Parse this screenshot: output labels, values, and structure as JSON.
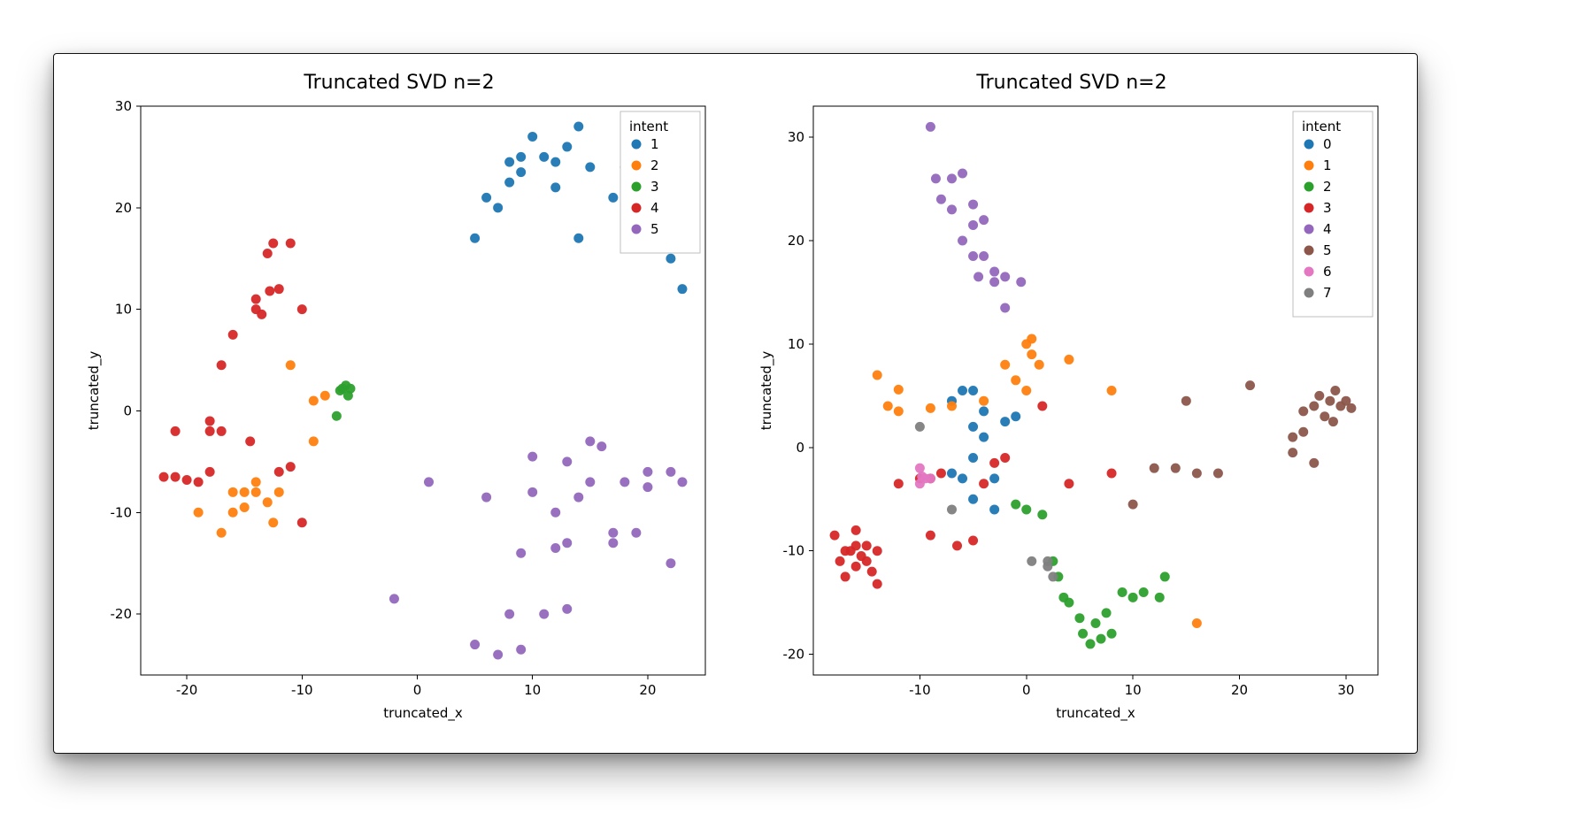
{
  "chart_data": [
    {
      "type": "scatter",
      "title": "Truncated SVD n=2",
      "xlabel": "truncated_x",
      "ylabel": "truncated_y",
      "xlim": [
        -24,
        25
      ],
      "ylim": [
        -26,
        30
      ],
      "xticks": [
        -20,
        -10,
        0,
        10,
        20
      ],
      "yticks": [
        -20,
        -10,
        0,
        10,
        20,
        30
      ],
      "legend_title": "intent",
      "legend_labels": [
        "1",
        "2",
        "3",
        "4",
        "5"
      ],
      "colors": {
        "1": "#1f77b4",
        "2": "#ff7f0e",
        "3": "#2ca02c",
        "4": "#d62728",
        "5": "#9467bd"
      },
      "series": [
        {
          "name": "1",
          "points": [
            [
              5,
              17
            ],
            [
              6,
              21
            ],
            [
              7,
              20
            ],
            [
              8,
              24.5
            ],
            [
              8,
              22.5
            ],
            [
              9,
              23.5
            ],
            [
              9,
              25
            ],
            [
              10,
              27
            ],
            [
              11,
              25
            ],
            [
              12,
              24.5
            ],
            [
              12,
              22
            ],
            [
              13,
              26
            ],
            [
              14,
              28
            ],
            [
              14,
              17
            ],
            [
              15,
              24
            ],
            [
              17,
              21
            ],
            [
              18,
              24
            ],
            [
              19,
              21
            ],
            [
              22,
              15
            ],
            [
              23,
              12
            ]
          ]
        },
        {
          "name": "2",
          "points": [
            [
              -19,
              -10
            ],
            [
              -17,
              -12
            ],
            [
              -16,
              -10
            ],
            [
              -16,
              -8
            ],
            [
              -15,
              -8
            ],
            [
              -15,
              -9.5
            ],
            [
              -14,
              -8
            ],
            [
              -14,
              -7
            ],
            [
              -13,
              -9
            ],
            [
              -12.5,
              -11
            ],
            [
              -12,
              -8
            ],
            [
              -11,
              4.5
            ],
            [
              -9,
              1
            ],
            [
              -9,
              -3
            ],
            [
              -8,
              1.5
            ]
          ]
        },
        {
          "name": "3",
          "points": [
            [
              -7,
              -0.5
            ],
            [
              -6.7,
              2
            ],
            [
              -6,
              1.5
            ],
            [
              -6.5,
              2.2
            ],
            [
              -6.2,
              2.5
            ],
            [
              -5.8,
              2.2
            ]
          ]
        },
        {
          "name": "4",
          "points": [
            [
              -22,
              -6.5
            ],
            [
              -21,
              -6.5
            ],
            [
              -21,
              -2
            ],
            [
              -20,
              -6.8
            ],
            [
              -19,
              -7
            ],
            [
              -18,
              -1
            ],
            [
              -18,
              -6
            ],
            [
              -18,
              -2
            ],
            [
              -17,
              -2
            ],
            [
              -17,
              4.5
            ],
            [
              -16,
              7.5
            ],
            [
              -14.5,
              -3
            ],
            [
              -14,
              11
            ],
            [
              -14,
              10
            ],
            [
              -13.5,
              9.5
            ],
            [
              -13,
              15.5
            ],
            [
              -12.8,
              11.8
            ],
            [
              -12.5,
              16.5
            ],
            [
              -12,
              12
            ],
            [
              -12,
              -6
            ],
            [
              -11,
              16.5
            ],
            [
              -11,
              -5.5
            ],
            [
              -10,
              10
            ],
            [
              -10,
              -11
            ]
          ]
        },
        {
          "name": "5",
          "points": [
            [
              1,
              -7
            ],
            [
              -2,
              -18.5
            ],
            [
              5,
              -23
            ],
            [
              6,
              -8.5
            ],
            [
              7,
              -24
            ],
            [
              8,
              -20
            ],
            [
              9,
              -14
            ],
            [
              9,
              -23.5
            ],
            [
              10,
              -4.5
            ],
            [
              10,
              -8
            ],
            [
              11,
              -20
            ],
            [
              12,
              -10
            ],
            [
              12,
              -13.5
            ],
            [
              13,
              -5
            ],
            [
              13,
              -13
            ],
            [
              13,
              -19.5
            ],
            [
              14,
              -8.5
            ],
            [
              15,
              -3
            ],
            [
              15,
              -7
            ],
            [
              16,
              -3.5
            ],
            [
              17,
              -13
            ],
            [
              18,
              -7
            ],
            [
              17,
              -12
            ],
            [
              19,
              -12
            ],
            [
              20,
              -6
            ],
            [
              20,
              -7.5
            ],
            [
              22,
              -6
            ],
            [
              23,
              -7
            ],
            [
              22,
              -15
            ]
          ]
        }
      ]
    },
    {
      "type": "scatter",
      "title": "Truncated SVD n=2",
      "xlabel": "truncated_x",
      "ylabel": "truncated_y",
      "xlim": [
        -20,
        33
      ],
      "ylim": [
        -22,
        33
      ],
      "xticks": [
        -10,
        0,
        10,
        20,
        30
      ],
      "yticks": [
        -20,
        -10,
        0,
        10,
        20,
        30
      ],
      "legend_title": "intent",
      "legend_labels": [
        "0",
        "1",
        "2",
        "3",
        "4",
        "5",
        "6",
        "7"
      ],
      "colors": {
        "0": "#1f77b4",
        "1": "#ff7f0e",
        "2": "#2ca02c",
        "3": "#d62728",
        "4": "#9467bd",
        "5": "#8c564b",
        "6": "#e377c2",
        "7": "#7f7f7f"
      },
      "series": [
        {
          "name": "0",
          "points": [
            [
              -7,
              4.5
            ],
            [
              -6,
              5.5
            ],
            [
              -5,
              5.5
            ],
            [
              -4,
              3.5
            ],
            [
              -5,
              2
            ],
            [
              -7,
              -2.5
            ],
            [
              -5,
              -1
            ],
            [
              -4,
              1
            ],
            [
              -6,
              -3
            ],
            [
              -5,
              -5
            ],
            [
              -3,
              -6
            ],
            [
              -3,
              -3
            ],
            [
              -2,
              2.5
            ],
            [
              -1,
              3
            ]
          ]
        },
        {
          "name": "1",
          "points": [
            [
              -14,
              7
            ],
            [
              -12,
              5.6
            ],
            [
              -13,
              4
            ],
            [
              -12,
              3.5
            ],
            [
              -9,
              3.8
            ],
            [
              -7,
              4
            ],
            [
              -4,
              4.5
            ],
            [
              -2,
              8
            ],
            [
              -1,
              6.5
            ],
            [
              0,
              10
            ],
            [
              0.5,
              9
            ],
            [
              0.5,
              10.5
            ],
            [
              0,
              5.5
            ],
            [
              1.2,
              8
            ],
            [
              4,
              8.5
            ],
            [
              8,
              5.5
            ],
            [
              16,
              -17
            ]
          ]
        },
        {
          "name": "2",
          "points": [
            [
              -1,
              -5.5
            ],
            [
              0,
              -6
            ],
            [
              1.5,
              -6.5
            ],
            [
              2.5,
              -11
            ],
            [
              3,
              -12.5
            ],
            [
              3.5,
              -14.5
            ],
            [
              4,
              -15
            ],
            [
              5,
              -16.5
            ],
            [
              5.3,
              -18
            ],
            [
              6,
              -19
            ],
            [
              6.5,
              -17
            ],
            [
              7,
              -18.5
            ],
            [
              7.5,
              -16
            ],
            [
              8,
              -18
            ],
            [
              9,
              -14
            ],
            [
              10,
              -14.5
            ],
            [
              11,
              -14
            ],
            [
              12.5,
              -14.5
            ],
            [
              13,
              -12.5
            ]
          ]
        },
        {
          "name": "3",
          "points": [
            [
              -18,
              -8.5
            ],
            [
              -17,
              -10
            ],
            [
              -17.5,
              -11
            ],
            [
              -16.5,
              -10
            ],
            [
              -17,
              -12.5
            ],
            [
              -16,
              -11.5
            ],
            [
              -16,
              -9.5
            ],
            [
              -16,
              -8
            ],
            [
              -15.5,
              -10.5
            ],
            [
              -15,
              -9.5
            ],
            [
              -15,
              -11
            ],
            [
              -14,
              -10
            ],
            [
              -14.5,
              -12
            ],
            [
              -14,
              -13.2
            ],
            [
              -12,
              -3.5
            ],
            [
              -10,
              -3
            ],
            [
              -9,
              -3
            ],
            [
              -9,
              -8.5
            ],
            [
              -8,
              -2.5
            ],
            [
              -6.5,
              -9.5
            ],
            [
              -5,
              -9
            ],
            [
              -4,
              -3.5
            ],
            [
              -3,
              -1.5
            ],
            [
              -2,
              -1
            ],
            [
              4,
              -3.5
            ],
            [
              1.5,
              4
            ],
            [
              8,
              -2.5
            ]
          ]
        },
        {
          "name": "4",
          "points": [
            [
              -9,
              31
            ],
            [
              -8.5,
              26
            ],
            [
              -8,
              24
            ],
            [
              -7,
              26
            ],
            [
              -7,
              23
            ],
            [
              -6,
              26.5
            ],
            [
              -6,
              20
            ],
            [
              -5,
              23.5
            ],
            [
              -5,
              21.5
            ],
            [
              -5,
              18.5
            ],
            [
              -4,
              18.5
            ],
            [
              -4,
              22
            ],
            [
              -4.5,
              16.5
            ],
            [
              -3,
              17
            ],
            [
              -3,
              16
            ],
            [
              -2,
              16.5
            ],
            [
              -2,
              13.5
            ],
            [
              -0.5,
              16
            ]
          ]
        },
        {
          "name": "5",
          "points": [
            [
              10,
              -5.5
            ],
            [
              12,
              -2
            ],
            [
              14,
              -2
            ],
            [
              15,
              4.5
            ],
            [
              16,
              -2.5
            ],
            [
              18,
              -2.5
            ],
            [
              21,
              6
            ],
            [
              25,
              1
            ],
            [
              25,
              -0.5
            ],
            [
              26,
              3.5
            ],
            [
              26,
              1.5
            ],
            [
              27,
              4
            ],
            [
              27.5,
              5
            ],
            [
              28,
              3
            ],
            [
              28.5,
              4.5
            ],
            [
              28.8,
              2.5
            ],
            [
              29,
              5.5
            ],
            [
              29.5,
              4
            ],
            [
              30,
              4.5
            ],
            [
              30.5,
              3.8
            ],
            [
              27,
              -1.5
            ]
          ]
        },
        {
          "name": "6",
          "points": [
            [
              -10,
              -2
            ],
            [
              -9.5,
              -3
            ],
            [
              -10,
              -3.5
            ],
            [
              -9,
              -3
            ],
            [
              -9.8,
              -2.8
            ]
          ]
        },
        {
          "name": "7",
          "points": [
            [
              -10,
              2
            ],
            [
              -7,
              -6
            ],
            [
              0.5,
              -11
            ],
            [
              2,
              -11.5
            ],
            [
              2.5,
              -12.5
            ],
            [
              2,
              -11
            ]
          ]
        }
      ]
    }
  ]
}
